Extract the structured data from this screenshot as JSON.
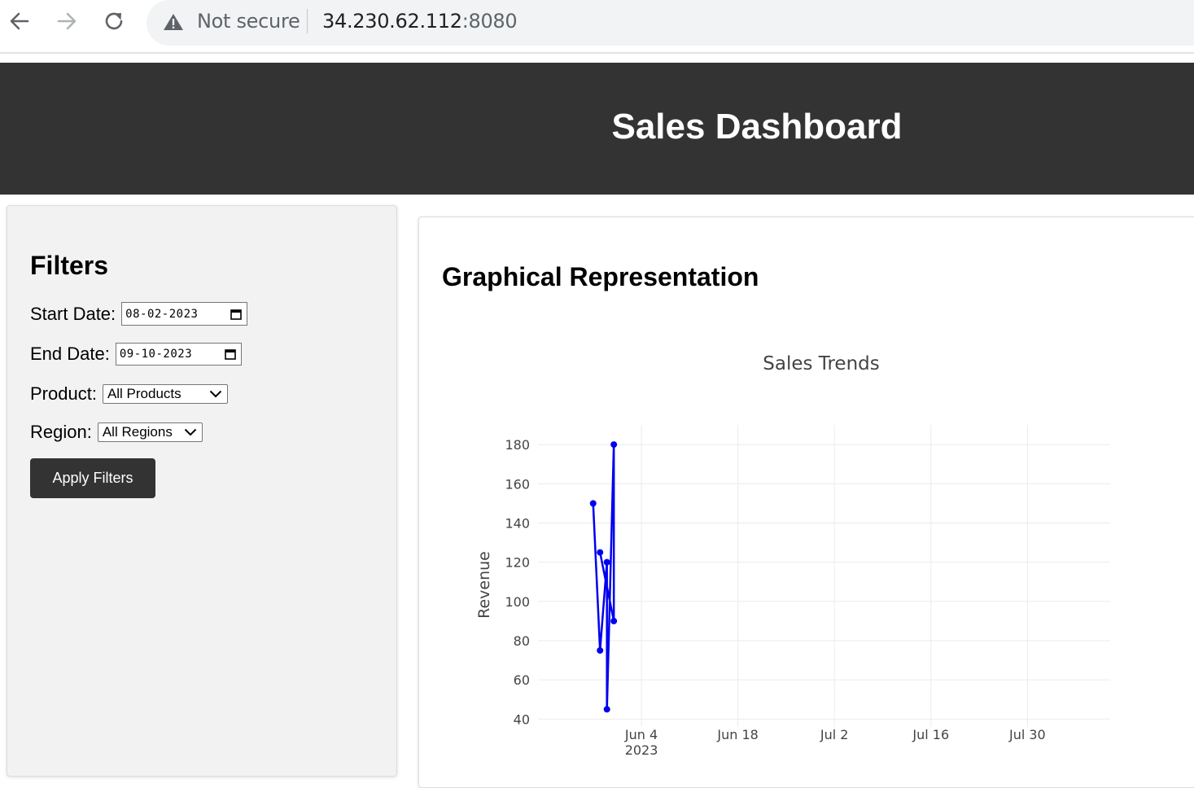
{
  "browser": {
    "security_label": "Not secure",
    "url_host": "34.230.62.112",
    "url_port": ":8080"
  },
  "header": {
    "title": "Sales Dashboard"
  },
  "filters": {
    "heading": "Filters",
    "start_date_label": "Start Date:",
    "start_date_value": "08-02-2023",
    "end_date_label": "End Date:",
    "end_date_value": "09-10-2023",
    "product_label": "Product:",
    "product_value": "All Products",
    "region_label": "Region:",
    "region_value": "All Regions",
    "apply_label": "Apply Filters"
  },
  "chart_panel": {
    "heading": "Graphical Representation"
  },
  "chart_data": {
    "type": "line",
    "title": "Sales Trends",
    "xlabel": "",
    "ylabel": "Revenue",
    "ylim": [
      36,
      190
    ],
    "xlim": [
      "2023-05-20",
      "2023-08-11"
    ],
    "y_ticks": [
      40,
      60,
      80,
      100,
      120,
      140,
      160,
      180
    ],
    "x_ticks": [
      {
        "date": "2023-06-04",
        "label": "Jun 4",
        "sublabel": "2023"
      },
      {
        "date": "2023-06-18",
        "label": "Jun 18"
      },
      {
        "date": "2023-07-02",
        "label": "Jul 2"
      },
      {
        "date": "2023-07-16",
        "label": "Jul 16"
      },
      {
        "date": "2023-07-30",
        "label": "Jul 30"
      }
    ],
    "grid": true,
    "color": "#0000ee",
    "series": [
      {
        "points": [
          {
            "x": "2023-05-28",
            "y": 150
          },
          {
            "x": "2023-05-29",
            "y": 75
          },
          {
            "x": "2023-05-30",
            "y": 120
          },
          {
            "x": "2023-05-30",
            "y": 45
          },
          {
            "x": "2023-05-31",
            "y": 180
          },
          {
            "x": "2023-05-31",
            "y": 90
          },
          {
            "x": "2023-05-29",
            "y": 125
          }
        ]
      }
    ]
  }
}
